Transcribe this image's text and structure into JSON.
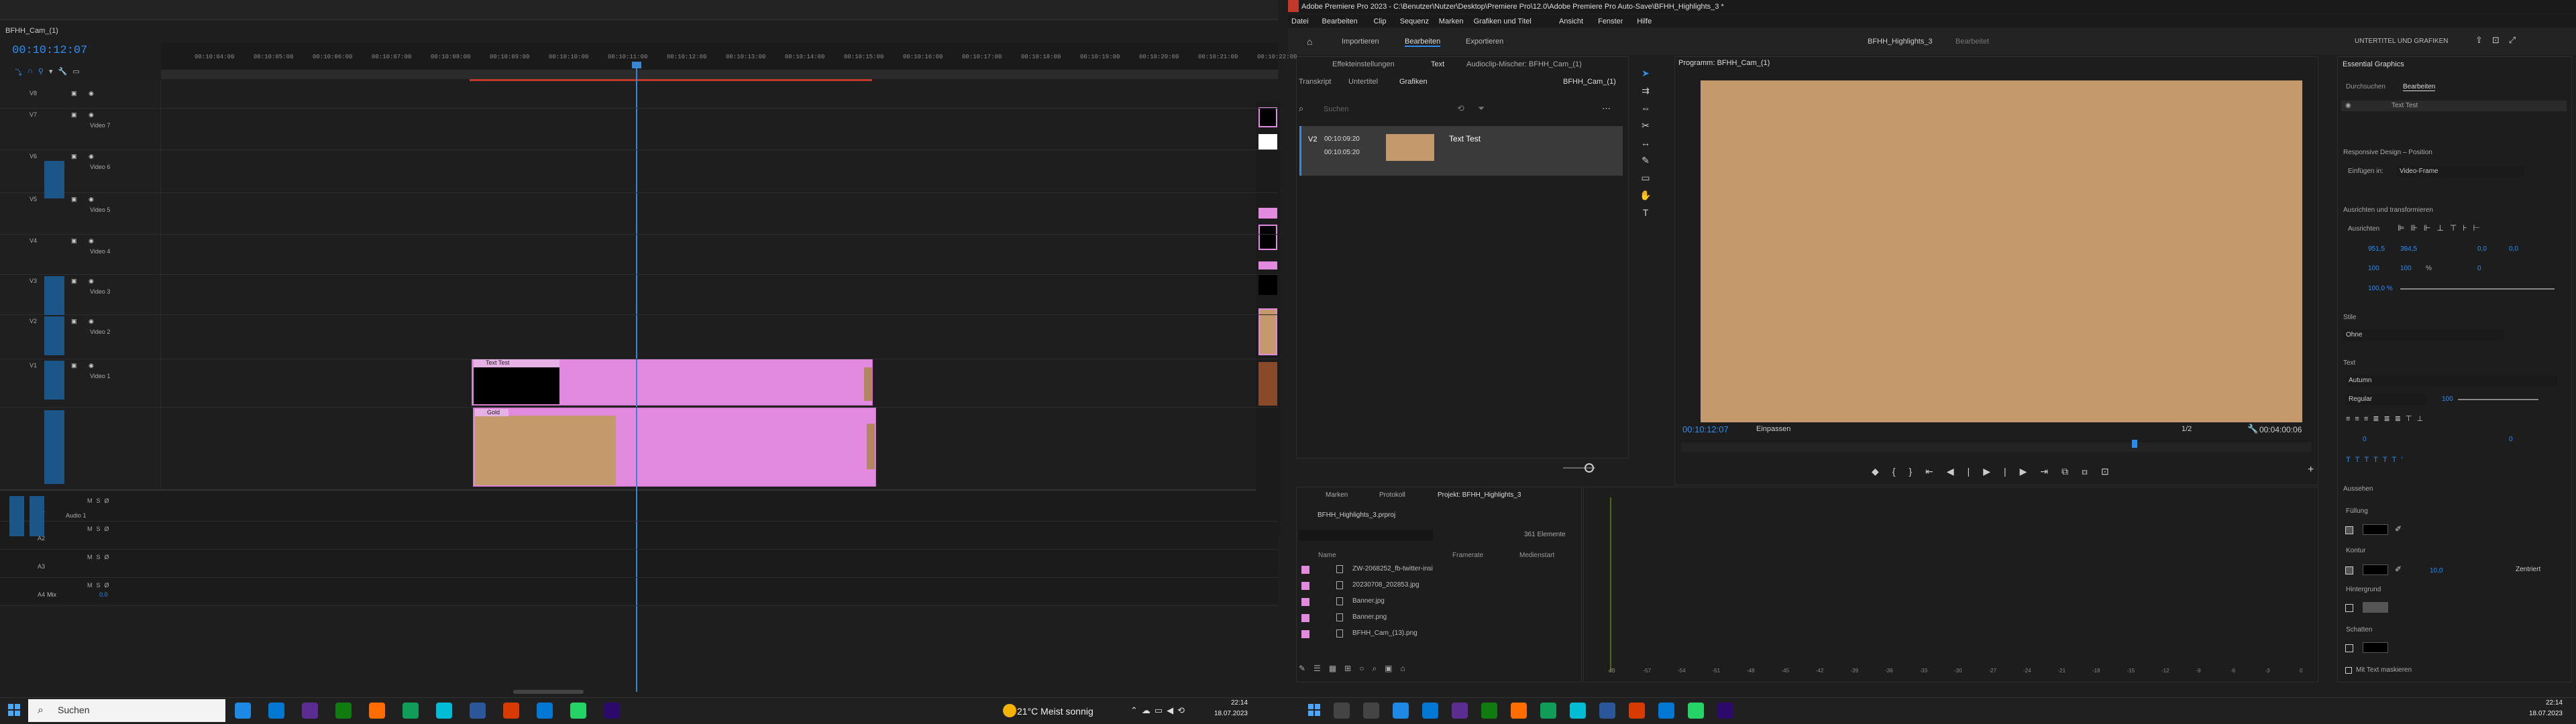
{
  "left": {
    "sequence_tab": "BFHH_Cam_(1)",
    "timecode": "00:10:12:07",
    "ruler_ticks": [
      "00:10:04:00",
      "00:10:05:00",
      "00:10:06:00",
      "00:10:07:00",
      "00:10:08:00",
      "00:10:09:00",
      "00:10:10:00",
      "00:10:11:00",
      "00:10:12:00",
      "00:10:13:00",
      "00:10:14:00",
      "00:10:15:00",
      "00:10:16:00",
      "00:10:17:00",
      "00:10:18:00",
      "00:10:19:00",
      "00:10:20:00",
      "00:10:21:00",
      "00:10:22:00"
    ],
    "tracks": [
      {
        "id": "V8",
        "name": ""
      },
      {
        "id": "V7",
        "name": "Video 7"
      },
      {
        "id": "V6",
        "name": "Video 6"
      },
      {
        "id": "V5",
        "name": "Video 5"
      },
      {
        "id": "V4",
        "name": "Video 4"
      },
      {
        "id": "V3",
        "name": "Video 3"
      },
      {
        "id": "V2",
        "name": "Video 2"
      },
      {
        "id": "V1",
        "name": "Video 1"
      }
    ],
    "clip_v2_label": "Text Test",
    "clip_v1_label": "Gold",
    "audio_tracks": [
      {
        "id": "A1",
        "name": "Audio 1"
      },
      {
        "id": "A2",
        "name": ""
      },
      {
        "id": "A3",
        "name": ""
      },
      {
        "id": "A4",
        "name": ""
      }
    ],
    "mix_label": "Mix",
    "mix_value": "0.0"
  },
  "taskbar_left": {
    "search_placeholder": "Suchen",
    "weather": "21°C  Meist sonnig",
    "time": "22:14",
    "date": "18.07.2023"
  },
  "right": {
    "title": "Adobe Premiere Pro 2023 - C:\\Benutzer\\Nutzer\\Desktop\\Premiere Pro\\12.0\\Adobe Premiere Pro Auto-Save\\BFHH_Highlights_3 *",
    "menu": [
      "Datei",
      "Bearbeiten",
      "Clip",
      "Sequenz",
      "Marken",
      "Grafiken und Titel",
      "Ansicht",
      "Fenster",
      "Hilfe"
    ],
    "workspaces": [
      "Importieren",
      "Bearbeiten",
      "Exportieren"
    ],
    "project_center": "BFHH_Highlights_3",
    "project_center_suffix": "Bearbeitet",
    "top_right": "UNTERTITEL UND GRAFIKEN",
    "text_panel": {
      "tabs_top": [
        "Effekteinstellungen",
        "Text",
        "Audioclip-Mischer: BFHH_Cam_(1)"
      ],
      "subtabs": [
        "Transkript",
        "Untertitel",
        "Grafiken"
      ],
      "seq_name": "BFHH_Cam_(1)",
      "search_placeholder": "Suchen",
      "item_track": "V2",
      "item_in": "00:10:09:20",
      "item_out": "00:10:05:20",
      "item_name": "Text Test"
    },
    "program": {
      "tab": "Programm: BFHH_Cam_(1)",
      "timecode": "00:10:12:07",
      "fit": "Einpassen",
      "quality": "1/2",
      "duration": "00:04:00:06"
    },
    "project": {
      "tabs": [
        "Marken",
        "Protokoll",
        "Projekt: BFHH_Highlights_3"
      ],
      "file": "BFHH_Highlights_3.prproj",
      "count": "361 Elemente",
      "columns": [
        "Name",
        "Framerate",
        "Medienstart"
      ],
      "files": [
        "ZW-2068252_fb-twitter-insi",
        "20230708_202853.jpg",
        "Banner.jpg",
        "Banner.png",
        "BFHH_Cam_(13).png"
      ]
    },
    "audio_meter_ticks": [
      "dB",
      "-57",
      "-54",
      "-51",
      "-48",
      "-45",
      "-42",
      "-39",
      "-36",
      "-33",
      "-30",
      "-27",
      "-24",
      "-21",
      "-18",
      "-15",
      "-12",
      "-9",
      "-6",
      "-3",
      "0"
    ],
    "essential_graphics": {
      "title": "Essential Graphics",
      "tabs": [
        "Durchsuchen",
        "Bearbeiten"
      ],
      "layer": "Text Test",
      "responsive": "Responsive Design – Position",
      "pin_label": "Einfügen in:",
      "pin_value": "Video-Frame",
      "align_label": "Ausrichten und transformieren",
      "align_sub": "Ausrichten",
      "pos_x": "951,5",
      "pos_y": "394,5",
      "anchor_x": "0,0",
      "anchor_y": "0,0",
      "scale": "100",
      "scale2": "100",
      "percent": "%",
      "rotation": "0",
      "opacity": "100,0 %",
      "style_label": "Stile",
      "style_value": "Ohne",
      "text_label": "Text",
      "font": "Autumn",
      "font_style": "Regular",
      "font_size": "100",
      "tracking": "0",
      "kerning": "0",
      "leading": "0",
      "appearance": "Aussehen",
      "fill": "Füllung",
      "stroke": "Kontur",
      "stroke_width": "10,0",
      "stroke_pos": "Zentriert",
      "background": "Hintergrund",
      "shadow": "Schatten",
      "mask": "Mit Text maskieren"
    }
  },
  "taskbar_right": {
    "time": "22:14",
    "date": "18.07.2023"
  },
  "colors": {
    "accent_blue": "#2d8ceb",
    "clip_pink": "#e28ae0",
    "clip_tan": "#c49a6c",
    "program_bg": "#c49a6c"
  }
}
